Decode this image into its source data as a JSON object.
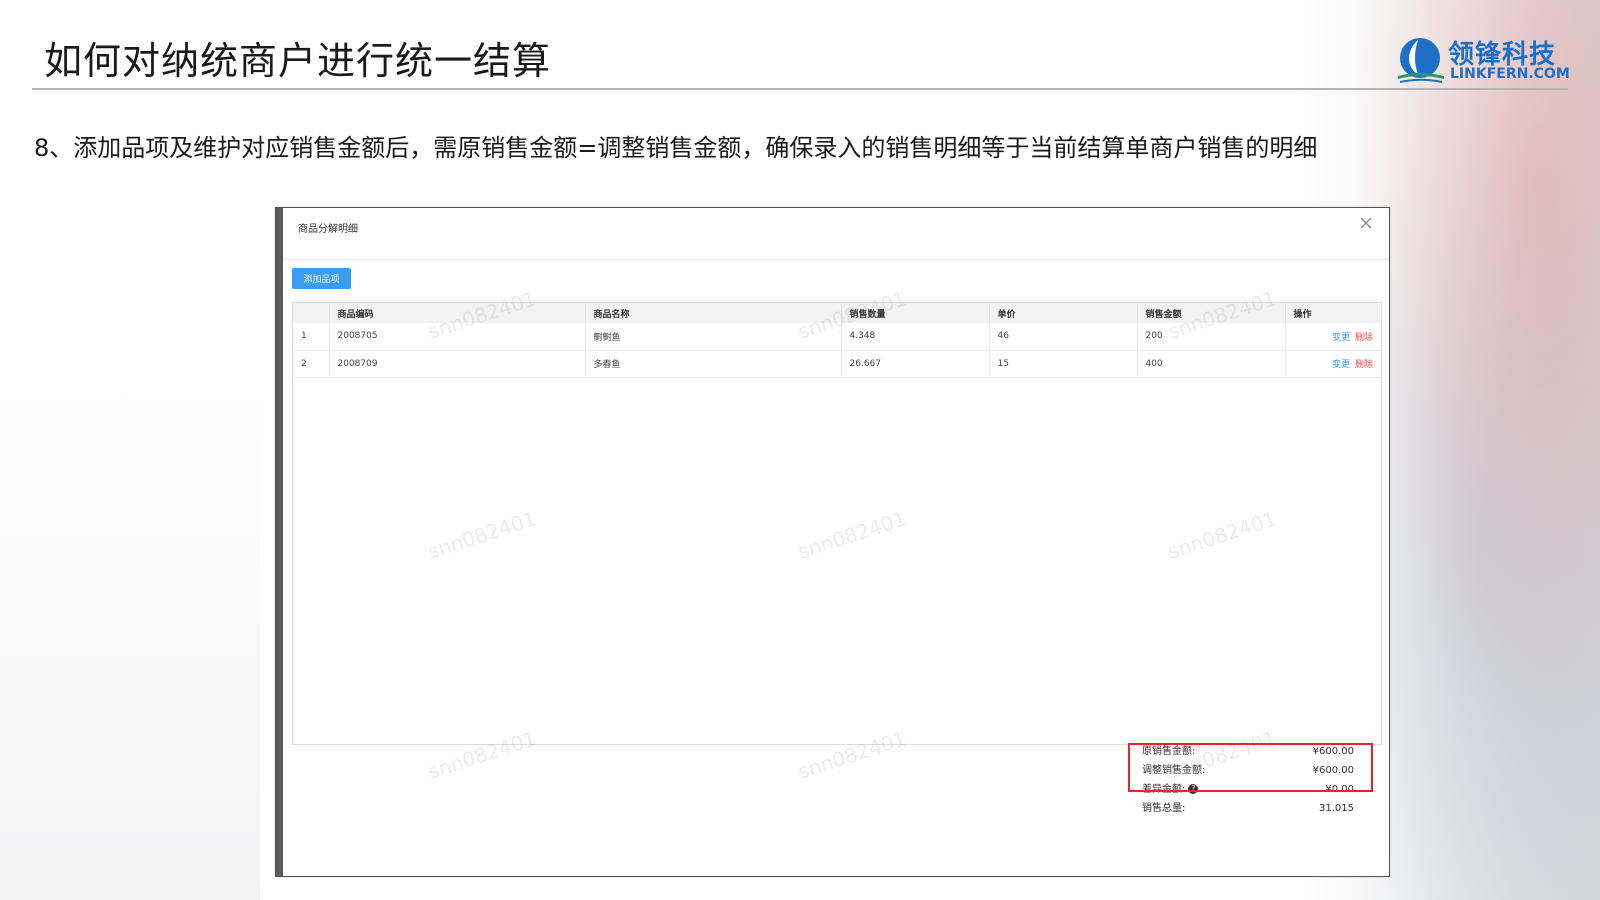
{
  "slide": {
    "title": "如何对纳统商户进行统一结算",
    "subtitle": "8、添加品项及维护对应销售金额后，需原销售金额=调整销售金额，确保录入的销售明细等于当前结算单商户销售的明细"
  },
  "logo": {
    "name_cn": "领锋科技",
    "name_en": "LINKFERN.COM",
    "color": "#1e6fc5"
  },
  "modal": {
    "title": "商品分解明细",
    "close_icon": "close-icon",
    "add_button": "添加品项",
    "columns": [
      "",
      "商品编码",
      "商品名称",
      "销售数量",
      "单价",
      "销售金额",
      "操作"
    ],
    "rows": [
      {
        "index": "1",
        "code": "2008705",
        "name": "鲥鲥鱼",
        "qty": "4.348",
        "price": "46",
        "amount": "200",
        "edit": "变更",
        "delete": "删除"
      },
      {
        "index": "2",
        "code": "2008709",
        "name": "多春鱼",
        "qty": "26.667",
        "price": "15",
        "amount": "400",
        "edit": "变更",
        "delete": "删除"
      }
    ],
    "summary": {
      "orig_label": "原销售金额:",
      "orig_value": "¥600.00",
      "adj_label": "调整销售金额:",
      "adj_value": "¥600.00",
      "diff_label": "差异金额:",
      "diff_value": "¥0.00",
      "total_label": "销售总量:",
      "total_value": "31.015"
    },
    "watermark_text": "snn082401"
  },
  "colors": {
    "primary_button": "#3c9cf0",
    "delete_link": "#f0505a",
    "highlight": "#e8232a"
  }
}
